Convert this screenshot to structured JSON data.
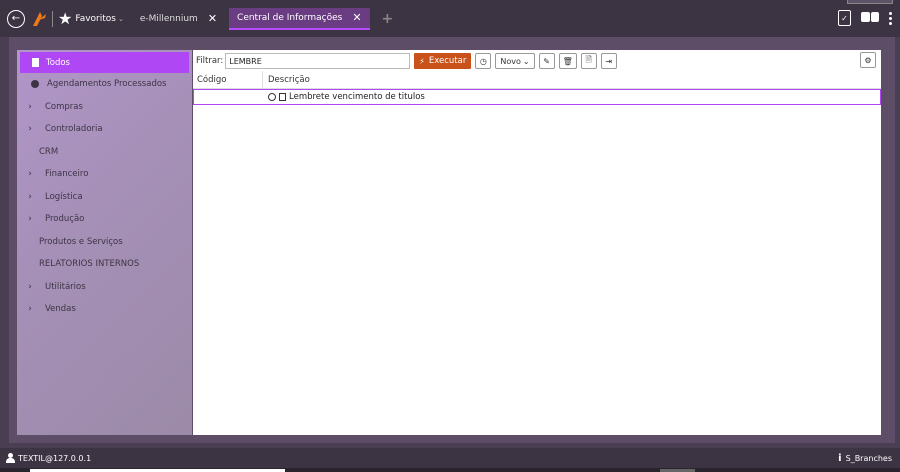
{
  "header": {
    "favorites_label": "Favoritos",
    "tabs": [
      {
        "label": "e-Millennium",
        "active": false
      },
      {
        "label": "Central de Informações",
        "active": true
      }
    ]
  },
  "sidebar": {
    "items": [
      {
        "label": "Todos",
        "type": "active"
      },
      {
        "label": "Agendamentos Processados",
        "type": "clock"
      },
      {
        "label": "Compras",
        "type": "expandable"
      },
      {
        "label": "Controladoria",
        "type": "expandable"
      },
      {
        "label": "CRM",
        "type": "plain"
      },
      {
        "label": "Financeiro",
        "type": "expandable"
      },
      {
        "label": "Logística",
        "type": "expandable"
      },
      {
        "label": "Produção",
        "type": "expandable"
      },
      {
        "label": "Produtos e Serviços",
        "type": "plain"
      },
      {
        "label": "RELATORIOS INTERNOS",
        "type": "plain"
      },
      {
        "label": "Utilitários",
        "type": "expandable"
      },
      {
        "label": "Vendas",
        "type": "expandable"
      }
    ]
  },
  "toolbar": {
    "filter_label": "Filtrar:",
    "filter_value": "LEMBRE",
    "execute_label": "Executar",
    "novo_label": "Novo"
  },
  "grid": {
    "columns": [
      "Código",
      "Descrição"
    ],
    "rows": [
      {
        "code": "",
        "description": "Lembrete vencimento de titulos"
      }
    ]
  },
  "status": {
    "user": "TEXTIL@127.0.0.1",
    "branch": "S_Branches"
  },
  "colors": {
    "accent": "#b047f5",
    "execute": "#c8521a",
    "chrome": "#3d3443"
  }
}
